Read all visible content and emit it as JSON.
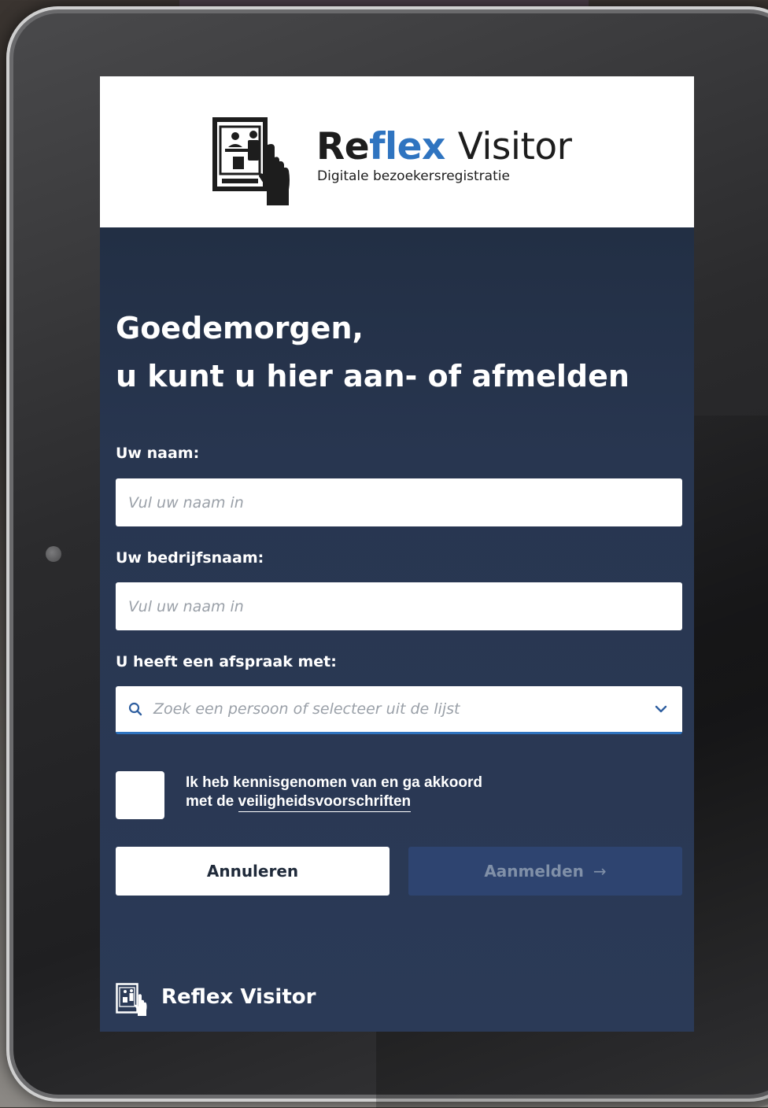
{
  "header": {
    "brand_part1": "Re",
    "brand_part2": "flex",
    "brand_part3": "Visitor",
    "tagline": "Digitale bezoekersregistratie"
  },
  "greeting": {
    "line1": "Goedemorgen,",
    "line2": "u kunt u hier aan- of afmelden"
  },
  "form": {
    "name_label": "Uw naam:",
    "name_placeholder": "Vul uw naam in",
    "company_label": "Uw bedrijfsnaam:",
    "company_placeholder": "Vul uw naam in",
    "appointment_label": "U heeft een afspraak met:",
    "appointment_placeholder": "Zoek een persoon of selecteer uit de lijst",
    "agree_line1": "Ik heb kennisgenomen van en ga akkoord",
    "agree_prefix": "met de",
    "agree_link": "veiligheidsvoorschriften",
    "cancel_label": "Annuleren",
    "submit_label": "Aanmelden",
    "submit_arrow": "→"
  },
  "footer": {
    "brand": "Reflex Visitor"
  },
  "colors": {
    "accent": "#2f74c0",
    "panel": "#283650",
    "submit_disabled": "#2e4470"
  },
  "icons": [
    "reflex-visitor-logo-icon",
    "search-icon",
    "chevron-down-icon",
    "arrow-right-icon"
  ]
}
